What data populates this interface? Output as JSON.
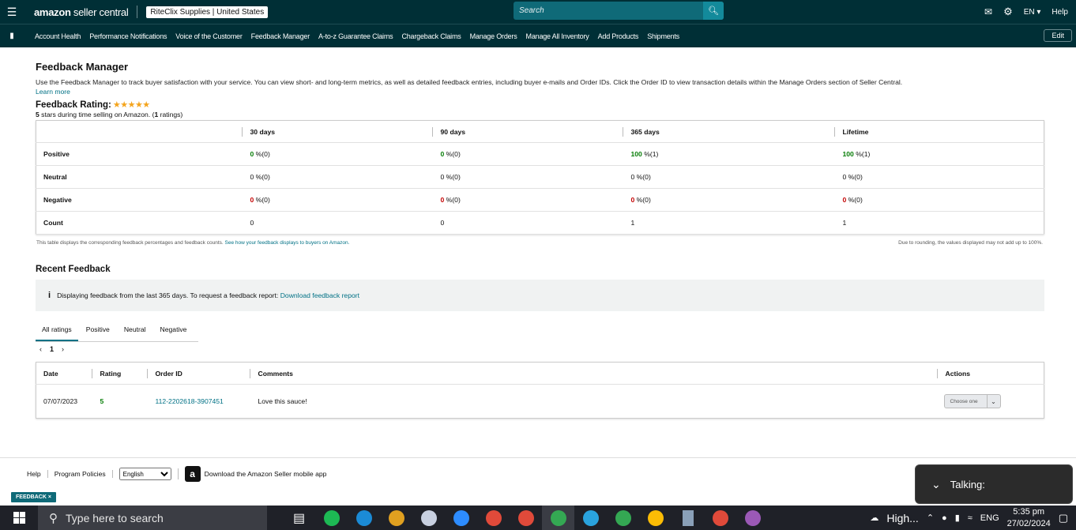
{
  "topbar": {
    "logo_main": "amazon",
    "logo_sub": " seller central",
    "store": "RiteClix Supplies | United States",
    "search_placeholder": "Search",
    "lang": "EN ▾",
    "help": "Help"
  },
  "nav": {
    "items": [
      "Account Health",
      "Performance Notifications",
      "Voice of the Customer",
      "Feedback Manager",
      "A-to-z Guarantee Claims",
      "Chargeback Claims",
      "Manage Orders",
      "Manage All Inventory",
      "Add Products",
      "Shipments"
    ],
    "edit": "Edit"
  },
  "page": {
    "title": "Feedback Manager",
    "description": "Use the Feedback Manager to track buyer satisfaction with your service. You can view short- and long-term metrics, as well as detailed feedback entries, including buyer e-mails and Order IDs. Click the Order ID to view transaction details within the Manage Orders section of Seller Central.",
    "learn_more": "Learn more",
    "rating_label": "Feedback Rating:",
    "stars": "★★★★★",
    "rating_stars_value": 5,
    "rating_sub_bold": "5",
    "rating_sub_mid": " stars during time selling on Amazon. (",
    "rating_sub_count": "1",
    "rating_sub_end": " ratings)"
  },
  "summary": {
    "columns": [
      "30 days",
      "90 days",
      "365 days",
      "Lifetime"
    ],
    "rows": [
      {
        "label": "Positive",
        "values": [
          [
            "0",
            " %(0)"
          ],
          [
            "0",
            " %(0)"
          ],
          [
            "100",
            " %(1)"
          ],
          [
            "100",
            " %(1)"
          ]
        ]
      },
      {
        "label": "Neutral",
        "values": [
          [
            "",
            "0 %(0)"
          ],
          [
            "",
            "0 %(0)"
          ],
          [
            "",
            "0 %(0)"
          ],
          [
            "",
            "0 %(0)"
          ]
        ]
      },
      {
        "label": "Negative",
        "values": [
          [
            "0",
            " %(0)"
          ],
          [
            "0",
            " %(0)"
          ],
          [
            "0",
            " %(0)"
          ],
          [
            "0",
            " %(0)"
          ]
        ]
      },
      {
        "label": "Count",
        "values": [
          [
            "",
            "0"
          ],
          [
            "",
            "0"
          ],
          [
            "",
            "1"
          ],
          [
            "",
            "1"
          ]
        ]
      }
    ],
    "note_left": "This table displays the corresponding feedback percentages and feedback counts. ",
    "note_left_link": "See how your feedback displays to buyers on Amazon.",
    "note_right": "Due to rounding, the values displayed may not add up to 100%."
  },
  "recent": {
    "title": "Recent Feedback",
    "info_text": "Displaying feedback from the last 365 days. To request a feedback report: ",
    "info_link": "Download feedback report",
    "tabs": [
      "All ratings",
      "Positive",
      "Neutral",
      "Negative"
    ],
    "page_number": "1",
    "columns": [
      "Date",
      "Rating",
      "Order ID",
      "Comments",
      "Actions"
    ],
    "rows": [
      {
        "date": "07/07/2023",
        "rating": "5",
        "order_id": "112-2202618-3907451",
        "comment": "Love this sauce!",
        "action": "Choose one"
      }
    ]
  },
  "footer": {
    "help": "Help",
    "policies": "Program Policies",
    "language": "English",
    "app_text": "Download the Amazon Seller mobile app",
    "feedback_tag": "FEEDBACK ×"
  },
  "talking": "Talking:",
  "taskbar": {
    "search_placeholder": "Type here to search",
    "weather": "High...",
    "lang": "ENG",
    "time": "5:35 pm",
    "date": "27/02/2024"
  },
  "colors": {
    "topbar": "#002f36",
    "link": "#007185",
    "positive": "#067d06",
    "negative": "#c40000",
    "star": "#f4a41c"
  }
}
